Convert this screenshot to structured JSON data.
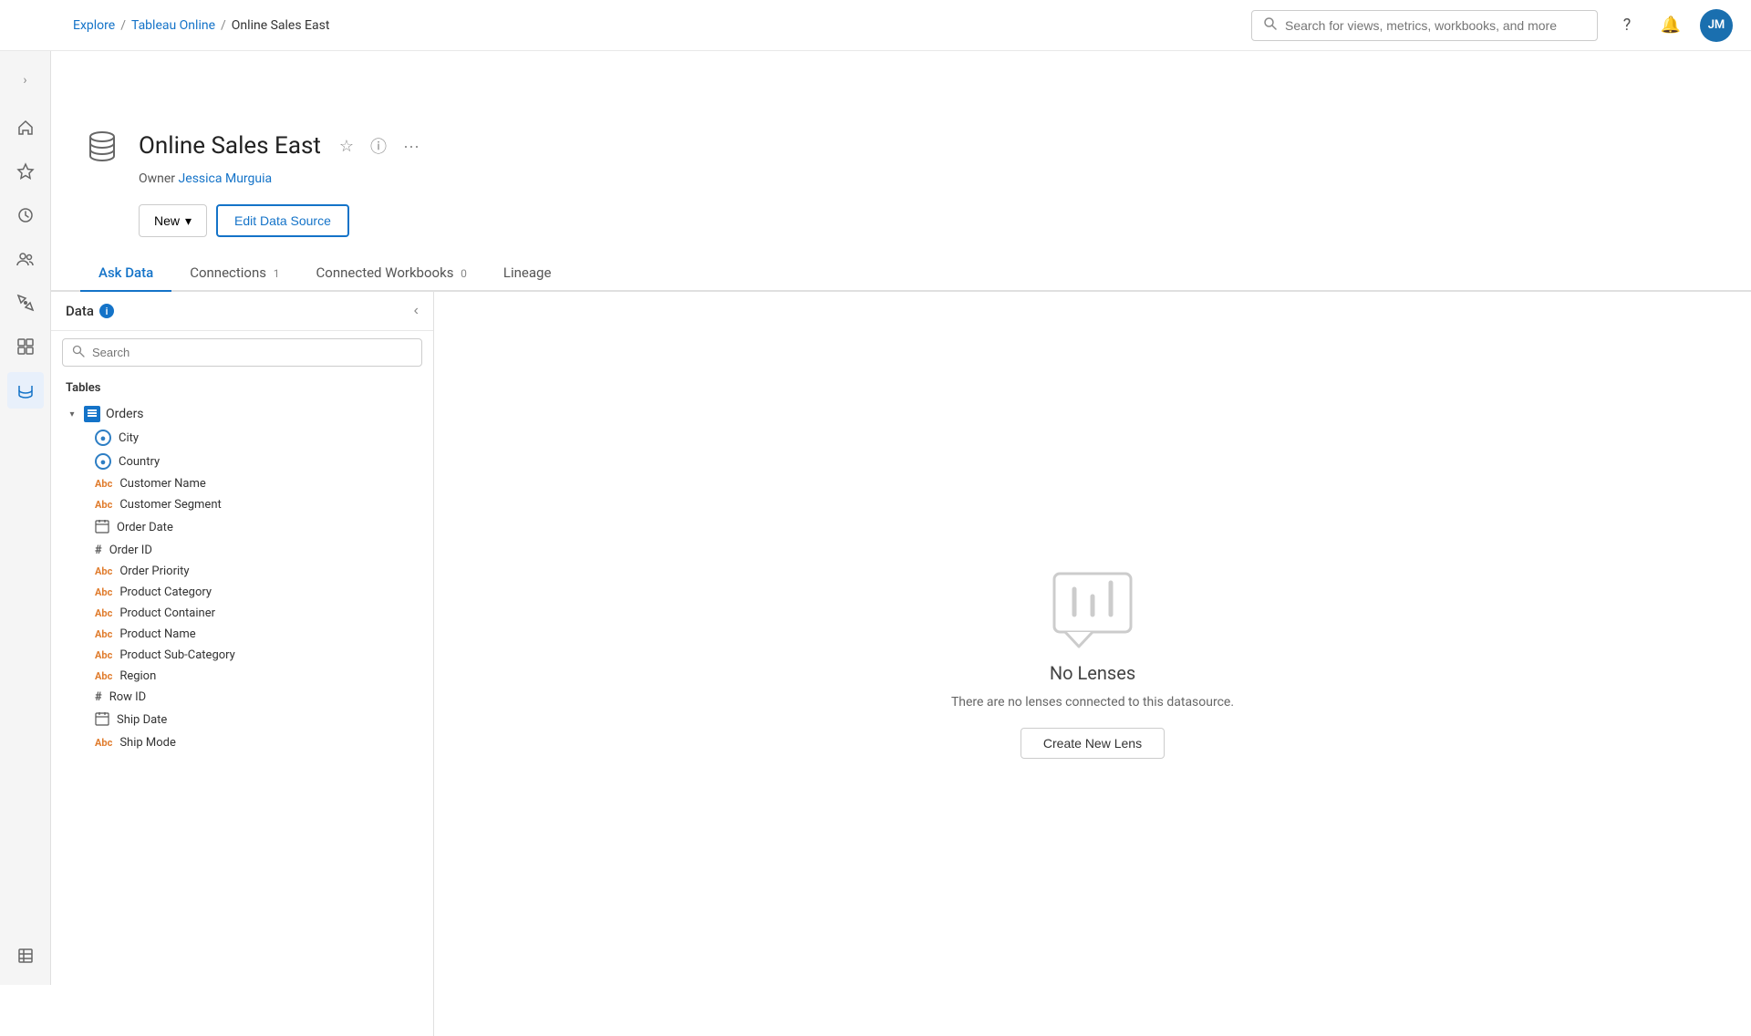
{
  "nav": {
    "breadcrumb": [
      "Explore",
      "Tableau Online",
      "Online Sales East"
    ],
    "search_placeholder": "Search for views, metrics, workbooks, and more",
    "avatar_initials": "JM"
  },
  "sidebar": {
    "expand_icon": "›",
    "items": [
      {
        "name": "home",
        "icon": "⌂"
      },
      {
        "name": "favorites",
        "icon": "★"
      },
      {
        "name": "recents",
        "icon": "◷"
      },
      {
        "name": "users",
        "icon": "👥"
      },
      {
        "name": "explore",
        "icon": "✦"
      },
      {
        "name": "analytics",
        "icon": "⊞"
      },
      {
        "name": "data",
        "icon": "⊙"
      },
      {
        "name": "catalog",
        "icon": "▤"
      }
    ]
  },
  "datasource": {
    "title": "Online Sales East",
    "owner_label": "Owner",
    "owner_name": "Jessica Murguia",
    "icon": "🗄"
  },
  "buttons": {
    "new": "New",
    "edit_data_source": "Edit Data Source"
  },
  "tabs": [
    {
      "label": "Ask Data",
      "badge": "",
      "active": true
    },
    {
      "label": "Connections",
      "badge": "1",
      "active": false
    },
    {
      "label": "Connected Workbooks",
      "badge": "0",
      "active": false
    },
    {
      "label": "Lineage",
      "badge": "",
      "active": false
    }
  ],
  "data_panel": {
    "title": "Data",
    "search_placeholder": "Search",
    "tables_label": "Tables",
    "tables": [
      {
        "name": "Orders",
        "fields": [
          {
            "name": "City",
            "type": "geo"
          },
          {
            "name": "Country",
            "type": "geo"
          },
          {
            "name": "Customer Name",
            "type": "abc"
          },
          {
            "name": "Customer Segment",
            "type": "abc"
          },
          {
            "name": "Order Date",
            "type": "date"
          },
          {
            "name": "Order ID",
            "type": "num"
          },
          {
            "name": "Order Priority",
            "type": "abc"
          },
          {
            "name": "Product Category",
            "type": "abc"
          },
          {
            "name": "Product Container",
            "type": "abc"
          },
          {
            "name": "Product Name",
            "type": "abc"
          },
          {
            "name": "Product Sub-Category",
            "type": "abc"
          },
          {
            "name": "Region",
            "type": "abc"
          },
          {
            "name": "Row ID",
            "type": "num"
          },
          {
            "name": "Ship Date",
            "type": "date"
          },
          {
            "name": "Ship Mode",
            "type": "abc"
          }
        ]
      }
    ]
  },
  "no_lenses": {
    "title": "No Lenses",
    "description": "There are no lenses connected to this datasource.",
    "button": "Create New Lens"
  }
}
